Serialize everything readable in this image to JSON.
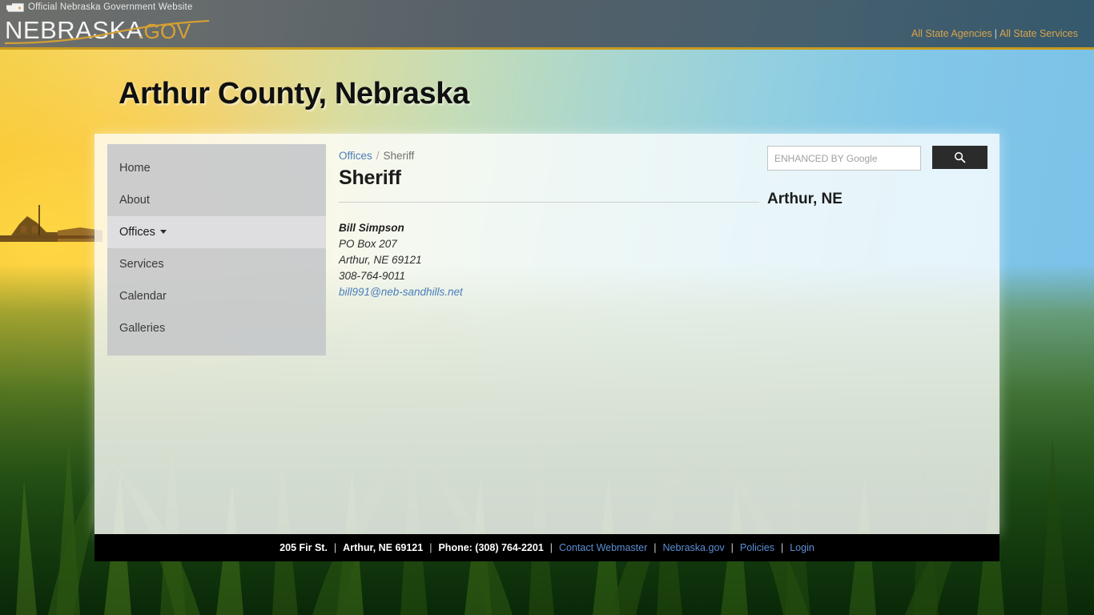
{
  "state_header": {
    "official_text": "Official Nebraska Government Website",
    "logo_primary": "NEBRASKA",
    "logo_suffix": ".GOV",
    "links": [
      {
        "label": "All State Agencies"
      },
      {
        "label": "All State Services"
      }
    ],
    "link_separator": "|",
    "gold_color": "#c79a1e",
    "link_color": "#d9a44c"
  },
  "page": {
    "county_title": "Arthur County, Nebraska"
  },
  "sidebar": {
    "items": [
      {
        "label": "Home",
        "active": false,
        "has_caret": false
      },
      {
        "label": "About",
        "active": false,
        "has_caret": false
      },
      {
        "label": "Offices",
        "active": true,
        "has_caret": true
      },
      {
        "label": "Services",
        "active": false,
        "has_caret": false
      },
      {
        "label": "Calendar",
        "active": false,
        "has_caret": false
      },
      {
        "label": "Galleries",
        "active": false,
        "has_caret": false
      }
    ]
  },
  "breadcrumb": {
    "parent": "Offices",
    "separator": "/",
    "current": "Sheriff"
  },
  "main": {
    "heading": "Sheriff",
    "contact": {
      "name": "Bill Simpson",
      "address_line1": "PO Box 207",
      "address_line2": "Arthur, NE  69121",
      "phone": "308-764-9011",
      "email": "bill991@neb-sandhills.net"
    }
  },
  "search": {
    "placeholder": "ENHANCED BY Google",
    "value": "",
    "button_icon": "search-icon"
  },
  "location": {
    "label": "Arthur, NE"
  },
  "footer": {
    "address": "205 Fir St.",
    "city_state_zip": "Arthur, NE 69121",
    "phone": "Phone: (308) 764-2201",
    "separator": "|",
    "links": [
      {
        "label": "Contact Webmaster"
      },
      {
        "label": "Nebraska.gov"
      },
      {
        "label": "Policies"
      },
      {
        "label": "Login"
      }
    ]
  }
}
